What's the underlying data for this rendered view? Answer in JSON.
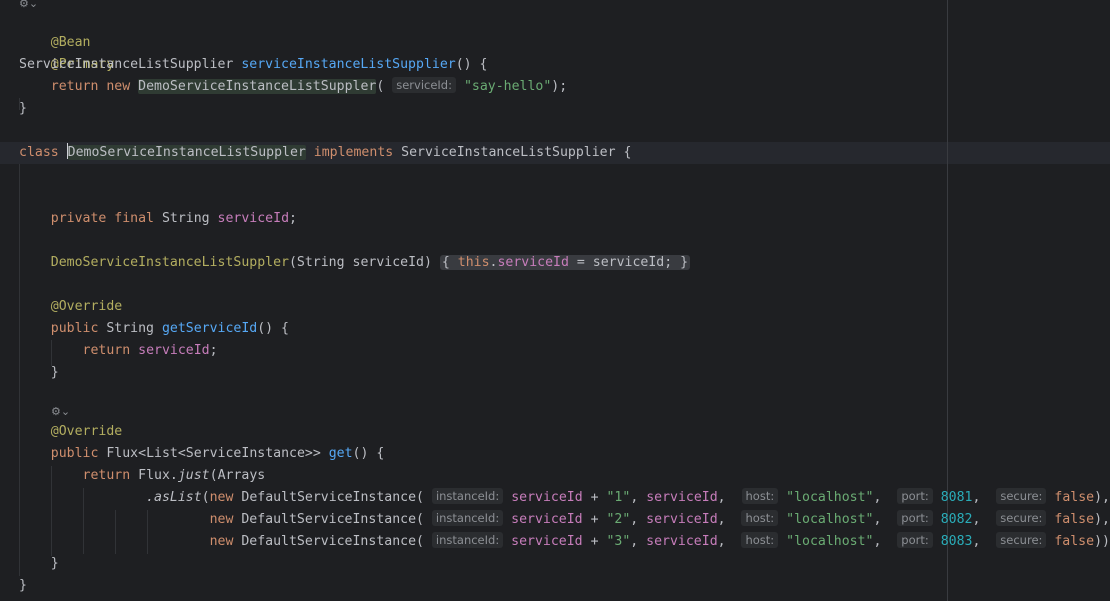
{
  "code": {
    "ann_bean": "@Bean",
    "ann_primary": "@Primary",
    "ann_override": "@Override",
    "kw_return": "return",
    "kw_new": "new",
    "kw_class": "class",
    "kw_implements": "implements",
    "kw_private": "private",
    "kw_final": "final",
    "kw_public": "public",
    "kw_this": "this",
    "type_supplier": "ServiceInstanceListSupplier",
    "method_supplier": "serviceInstanceListSupplier",
    "demo_class": "DemoServiceInstanceListSuppler",
    "type_string": "String",
    "field_service_id": "serviceId",
    "param_service_id": "serviceId",
    "method_get_service_id": "getServiceId",
    "type_flux": "Flux",
    "type_list": "List",
    "type_service_instance": "ServiceInstance",
    "method_get": "get",
    "flux_ref": "Flux",
    "method_just": "just",
    "arrays_ref": "Arrays",
    "method_as_list": "asList",
    "default_instance": "DefaultServiceInstance",
    "say_hello": "\"say-hello\"",
    "localhost": "\"localhost\"",
    "false_kw": "false"
  },
  "hints": {
    "service_id": "serviceId:",
    "instance_id": "instanceId:",
    "host": "host:",
    "port": "port:",
    "secure": "secure:"
  },
  "instances": [
    {
      "id": "\"1\"",
      "port": "8081",
      "tail": "),"
    },
    {
      "id": "\"2\"",
      "port": "8082",
      "tail": "),"
    },
    {
      "id": "\"3\"",
      "port": "8083",
      "tail": "));"
    }
  ],
  "icons": [
    "implementation-gutter-icon",
    "override-gutter-icon"
  ]
}
